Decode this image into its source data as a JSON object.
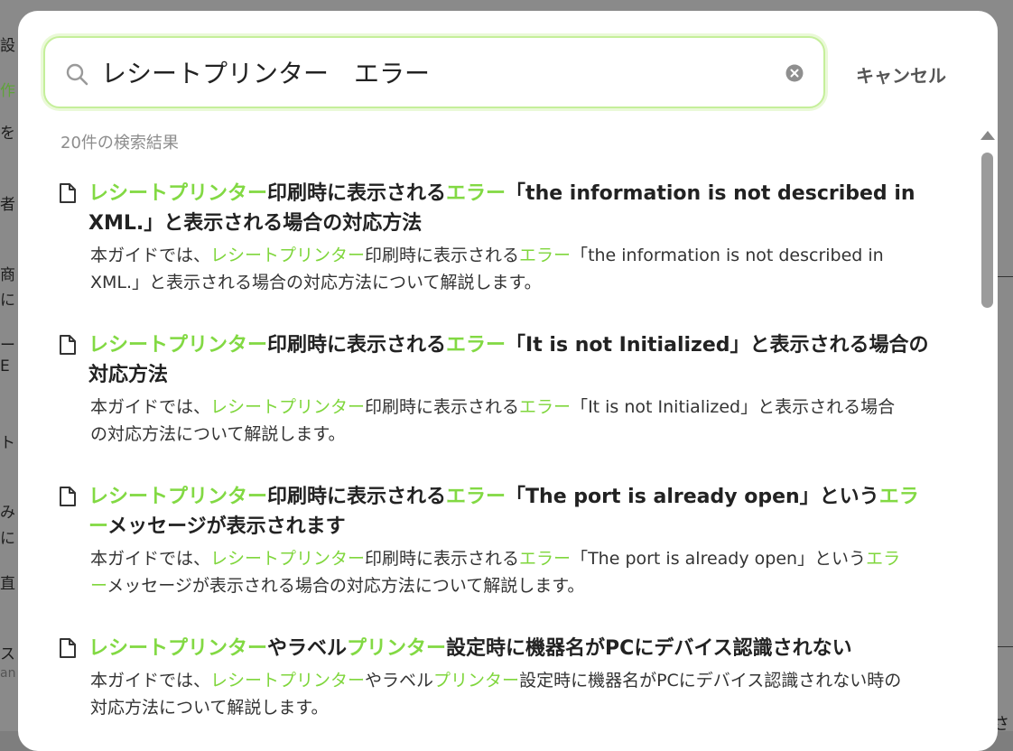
{
  "background": {
    "fragments": [
      "設",
      "作",
      "を",
      "者",
      "商",
      "に",
      "ー",
      "E",
      "ト",
      "み",
      "に",
      "直",
      "ス",
      "an"
    ],
    "right_fragment": "さ"
  },
  "search": {
    "value": "レシートプリンター　エラー",
    "cancel_label": "キャンセル"
  },
  "result_count": "20件の検索結果",
  "results": [
    {
      "title": [
        {
          "t": "レシートプリンター",
          "h": true
        },
        {
          "t": "印刷時に表示される",
          "h": false
        },
        {
          "t": "エラー",
          "h": true
        },
        {
          "t": "「the information is not described in XML.」と表示される場合の対応方法",
          "h": false
        }
      ],
      "snippet": [
        {
          "t": "本ガイドでは、",
          "h": false
        },
        {
          "t": "レシートプリンター",
          "h": true
        },
        {
          "t": "印刷時に表示される",
          "h": false
        },
        {
          "t": "エラー",
          "h": true
        },
        {
          "t": "「the information is not described in XML.」と表示される場合の対応方法について解説します。",
          "h": false
        }
      ]
    },
    {
      "title": [
        {
          "t": "レシートプリンター",
          "h": true
        },
        {
          "t": "印刷時に表示される",
          "h": false
        },
        {
          "t": "エラー",
          "h": true
        },
        {
          "t": "「It is not Initialized」と表示される場合の対応方法",
          "h": false
        }
      ],
      "snippet": [
        {
          "t": "本ガイドでは、",
          "h": false
        },
        {
          "t": "レシートプリンター",
          "h": true
        },
        {
          "t": "印刷時に表示される",
          "h": false
        },
        {
          "t": "エラー",
          "h": true
        },
        {
          "t": "「It is not Initialized」と表示される場合の対応方法について解説します。",
          "h": false
        }
      ]
    },
    {
      "title": [
        {
          "t": "レシートプリンター",
          "h": true
        },
        {
          "t": "印刷時に表示される",
          "h": false
        },
        {
          "t": "エラー",
          "h": true
        },
        {
          "t": "「The port is already open」という",
          "h": false
        },
        {
          "t": "エラー",
          "h": true
        },
        {
          "t": "メッセージが表示されます",
          "h": false
        }
      ],
      "snippet": [
        {
          "t": "本ガイドでは、",
          "h": false
        },
        {
          "t": "レシートプリンター",
          "h": true
        },
        {
          "t": "印刷時に表示される",
          "h": false
        },
        {
          "t": "エラー",
          "h": true
        },
        {
          "t": "「The port is already open」という",
          "h": false
        },
        {
          "t": "エラー",
          "h": true
        },
        {
          "t": "メッセージが表示される場合の対応方法について解説します。",
          "h": false
        }
      ]
    },
    {
      "title": [
        {
          "t": "レシートプリンター",
          "h": true
        },
        {
          "t": "やラベル",
          "h": false
        },
        {
          "t": "プリンター",
          "h": true
        },
        {
          "t": "設定時に機器名がPCにデバイス認識されない",
          "h": false
        }
      ],
      "snippet": [
        {
          "t": "本ガイドでは、",
          "h": false
        },
        {
          "t": "レシートプリンター",
          "h": true
        },
        {
          "t": "やラベル",
          "h": false
        },
        {
          "t": "プリンター",
          "h": true
        },
        {
          "t": "設定時に機器名がPCにデバイス認識されない時の対応方法について解説します。",
          "h": false
        }
      ]
    }
  ],
  "colors": {
    "highlight": "#7fd63c",
    "search_border": "#c5ef9a",
    "overlay": "#8a8a8a"
  },
  "icons": [
    "search-icon",
    "clear-icon",
    "document-icon",
    "scroll-up-icon"
  ]
}
